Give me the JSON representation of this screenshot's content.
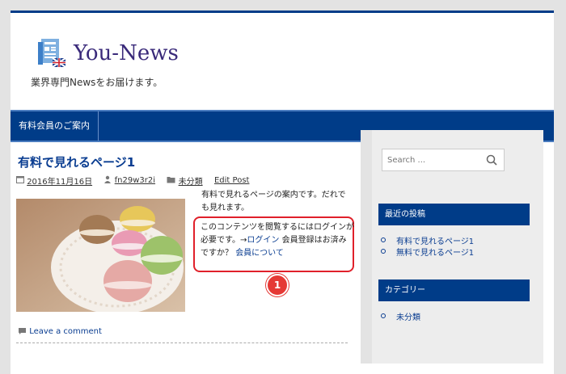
{
  "site": {
    "title": "You-News",
    "tagline": "業界専門Newsをお届けます。"
  },
  "nav": {
    "items": [
      {
        "label": "有料会員のご案内"
      }
    ]
  },
  "post": {
    "title": "有料で見れるページ1",
    "meta": {
      "date": "2016年11月16日",
      "author": "fn29w3r2i",
      "category": "未分類",
      "edit": "Edit Post"
    },
    "intro": "有料で見れるページの案内です。だれでも見れます。",
    "locked": {
      "text1": "このコンテンツを閲覧するにはログインが必要です。→",
      "login_link": "ログイン",
      "text2": " 会員登録はお済みですか？ ",
      "member_link": "会員について"
    },
    "callout_number": "1",
    "comment_link": "Leave a comment"
  },
  "sidebar": {
    "search": {
      "placeholder": "Search ..."
    },
    "recent": {
      "title": "最近の投稿",
      "items": [
        "有料で見れるページ1",
        "無料で見れるページ1"
      ]
    },
    "categories": {
      "title": "カテゴリー",
      "items": [
        "未分類"
      ]
    }
  },
  "colors": {
    "brand": "#003c88",
    "link": "#0a3d91",
    "highlight": "#e0202a"
  }
}
